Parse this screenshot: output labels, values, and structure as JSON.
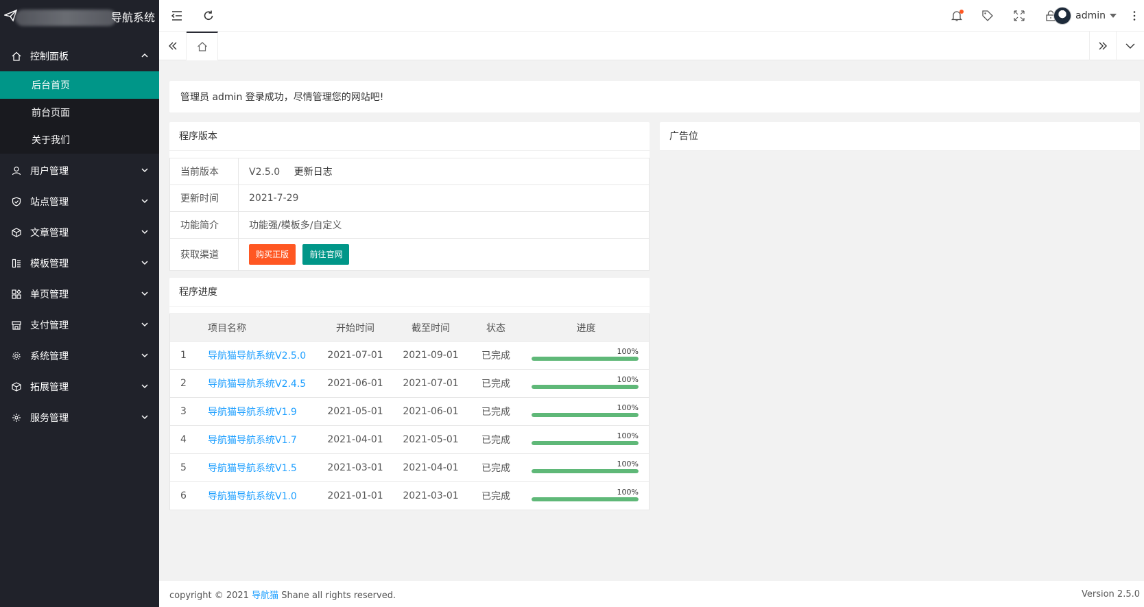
{
  "logo": {
    "text": "导航系统"
  },
  "sidebar": {
    "dashboard": {
      "label": "控制面板",
      "items": [
        "后台首页",
        "前台页面",
        "关于我们"
      ]
    },
    "groups": [
      {
        "label": "用户管理",
        "icon": "user-icon"
      },
      {
        "label": "站点管理",
        "icon": "shield-icon"
      },
      {
        "label": "文章管理",
        "icon": "cube-icon"
      },
      {
        "label": "模板管理",
        "icon": "template-icon"
      },
      {
        "label": "单页管理",
        "icon": "apps-icon"
      },
      {
        "label": "支付管理",
        "icon": "store-icon"
      },
      {
        "label": "系统管理",
        "icon": "gear-icon"
      },
      {
        "label": "拓展管理",
        "icon": "cube-icon"
      },
      {
        "label": "服务管理",
        "icon": "service-gear-icon"
      }
    ]
  },
  "header": {
    "username": "admin"
  },
  "welcome": "管理员 admin 登录成功，尽情管理您的网站吧!",
  "version_card": {
    "title": "程序版本",
    "rows": {
      "current_label": "当前版本",
      "current_value": "V2.5.0",
      "changelog": "更新日志",
      "update_label": "更新时间",
      "update_value": "2021-7-29",
      "feature_label": "功能简介",
      "feature_value": "功能强/模板多/自定义",
      "channel_label": "获取渠道",
      "buy_button": "购买正版",
      "site_button": "前往官网"
    }
  },
  "ad_card": {
    "title": "广告位"
  },
  "progress_card": {
    "title": "程序进度",
    "headers": [
      "项目名称",
      "开始时间",
      "截至时间",
      "状态",
      "进度"
    ],
    "rows": [
      {
        "num": "1",
        "name": "导航猫导航系统V2.5.0",
        "start": "2021-07-01",
        "end": "2021-09-01",
        "status": "已完成",
        "status_color": "orange",
        "progress": 100,
        "progress_text": "100%"
      },
      {
        "num": "2",
        "name": "导航猫导航系统V2.4.5",
        "start": "2021-06-01",
        "end": "2021-07-01",
        "status": "已完成",
        "status_color": "green",
        "progress": 100,
        "progress_text": "100%"
      },
      {
        "num": "3",
        "name": "导航猫导航系统V1.9",
        "start": "2021-05-01",
        "end": "2021-06-01",
        "status": "已完成",
        "status_color": "green",
        "progress": 100,
        "progress_text": "100%"
      },
      {
        "num": "4",
        "name": "导航猫导航系统V1.7",
        "start": "2021-04-01",
        "end": "2021-05-01",
        "status": "已完成",
        "status_color": "green",
        "progress": 100,
        "progress_text": "100%"
      },
      {
        "num": "5",
        "name": "导航猫导航系统V1.5",
        "start": "2021-03-01",
        "end": "2021-04-01",
        "status": "已完成",
        "status_color": "green",
        "progress": 100,
        "progress_text": "100%"
      },
      {
        "num": "6",
        "name": "导航猫导航系统V1.0",
        "start": "2021-01-01",
        "end": "2021-03-01",
        "status": "已完成",
        "status_color": "green",
        "progress": 100,
        "progress_text": "100%"
      }
    ]
  },
  "footer": {
    "prefix": "copyright © 2021 ",
    "link": "导航猫",
    "suffix": " Shane all rights reserved.",
    "version": "Version 2.5.0"
  },
  "colors": {
    "sidebar_bg": "#20222a",
    "accent": "#009688",
    "orange": "#ff5722",
    "green": "#5fb878",
    "link": "#1e9fff"
  }
}
